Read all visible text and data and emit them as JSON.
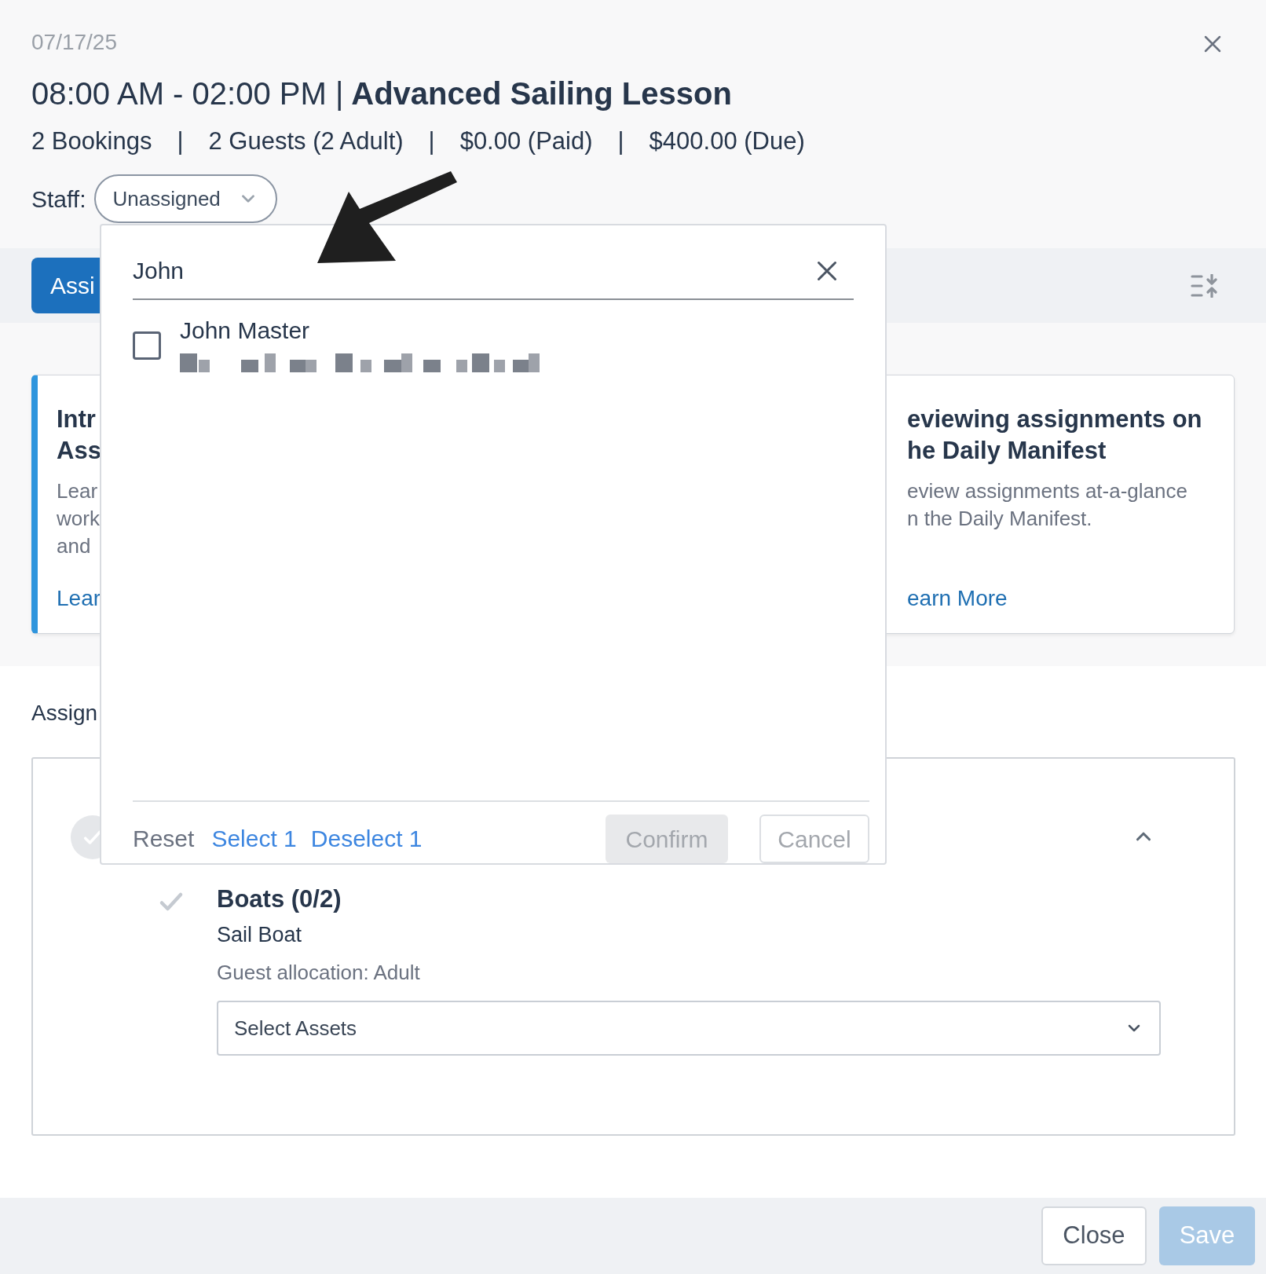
{
  "date": "07/17/25",
  "time_range": "08:00 AM - 02:00 PM |",
  "title": "Advanced Sailing Lesson",
  "summary": [
    "2 Bookings",
    "|",
    "2 Guests (2 Adult)",
    "|",
    "$0.00 (Paid)",
    "|",
    "$400.00 (Due)"
  ],
  "staff": {
    "label": "Staff:",
    "value": "Unassigned"
  },
  "tab_button": "Assi",
  "cards": [
    {
      "accent": true,
      "title_lines": [
        "Intr",
        "Ass"
      ],
      "body_lines": [
        "Lear",
        "work",
        "and"
      ],
      "link": "Lear"
    },
    {
      "accent": false,
      "title_lines": [
        "eviewing assignments on",
        "he Daily Manifest"
      ],
      "body_lines": [
        "eview assignments at-a-glance",
        "n the Daily Manifest."
      ],
      "link": "earn More"
    }
  ],
  "section_label": "Assign",
  "group": {
    "expanded": true,
    "item": {
      "title": "Boats (0/2)",
      "subtitle": "Sail Boat",
      "allocation": "Guest allocation: Adult",
      "select_placeholder": "Select Assets"
    }
  },
  "staff_dropdown": {
    "search_value": "John",
    "options": [
      {
        "name": "John Master",
        "checked": false
      }
    ],
    "actions": [
      "Reset",
      "Select 1",
      "Deselect 1"
    ],
    "confirm": {
      "label": "Confirm",
      "disabled": true
    },
    "cancel": "Cancel"
  },
  "footer": {
    "close": "Close",
    "save": {
      "label": "Save",
      "disabled": true
    }
  }
}
